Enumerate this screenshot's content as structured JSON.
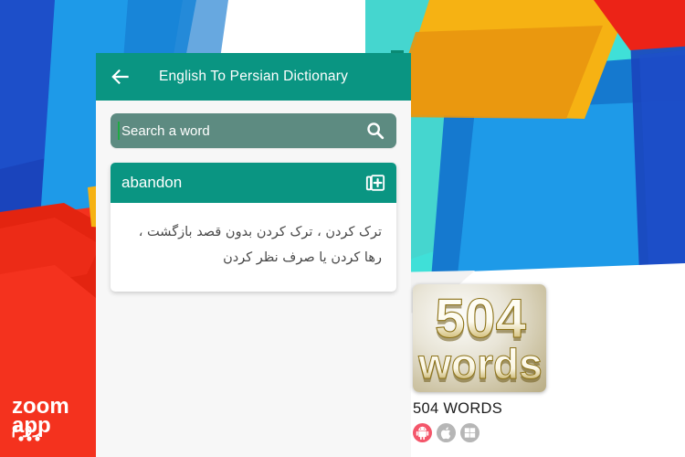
{
  "app": {
    "title": "English To Persian Dictionary",
    "back_icon": "arrow-back-icon",
    "search": {
      "placeholder": "Search a word",
      "value": "",
      "icon": "search-icon"
    },
    "result": {
      "word": "abandon",
      "add_icon": "library-add-icon",
      "meaning": "ترک کردن ، ترک کردن بدون قصد بازگشت ، رها کردن یا صرف نظر کردن"
    }
  },
  "listing": {
    "icon_text_top": "504",
    "icon_text_bottom": "words",
    "name": "504 WORDS",
    "platforms": [
      {
        "name": "android-icon",
        "color": "#f4566a"
      },
      {
        "name": "apple-icon",
        "color": "#b6b6b6"
      },
      {
        "name": "windows-icon",
        "color": "#b6b6b6"
      }
    ]
  },
  "brand": {
    "name_latin_top": "zoom",
    "name_latin_bottom": "app",
    "name_persian": "زوم اپ",
    "band_color": "#f4321e"
  },
  "colors": {
    "header_teal": "#0a9582",
    "search_field": "#5d8b81",
    "caret_green": "#1faa43",
    "panel_bg": "#f7f7f7",
    "card_white": "#ffffff",
    "meaning_text": "#4a4a4a",
    "bg_blue_deep": "#1a44bc",
    "bg_blue_bright": "#1e9ae8",
    "bg_blue_mid": "#1579cf",
    "bg_cyan": "#3fe0d8",
    "bg_teal": "#40c2b4",
    "bg_orange": "#f6b213",
    "bg_orange_dark": "#e8960f",
    "bg_red": "#f4321e",
    "bg_red_dark": "#e32410",
    "bg_green_dark": "#0a8a74"
  }
}
